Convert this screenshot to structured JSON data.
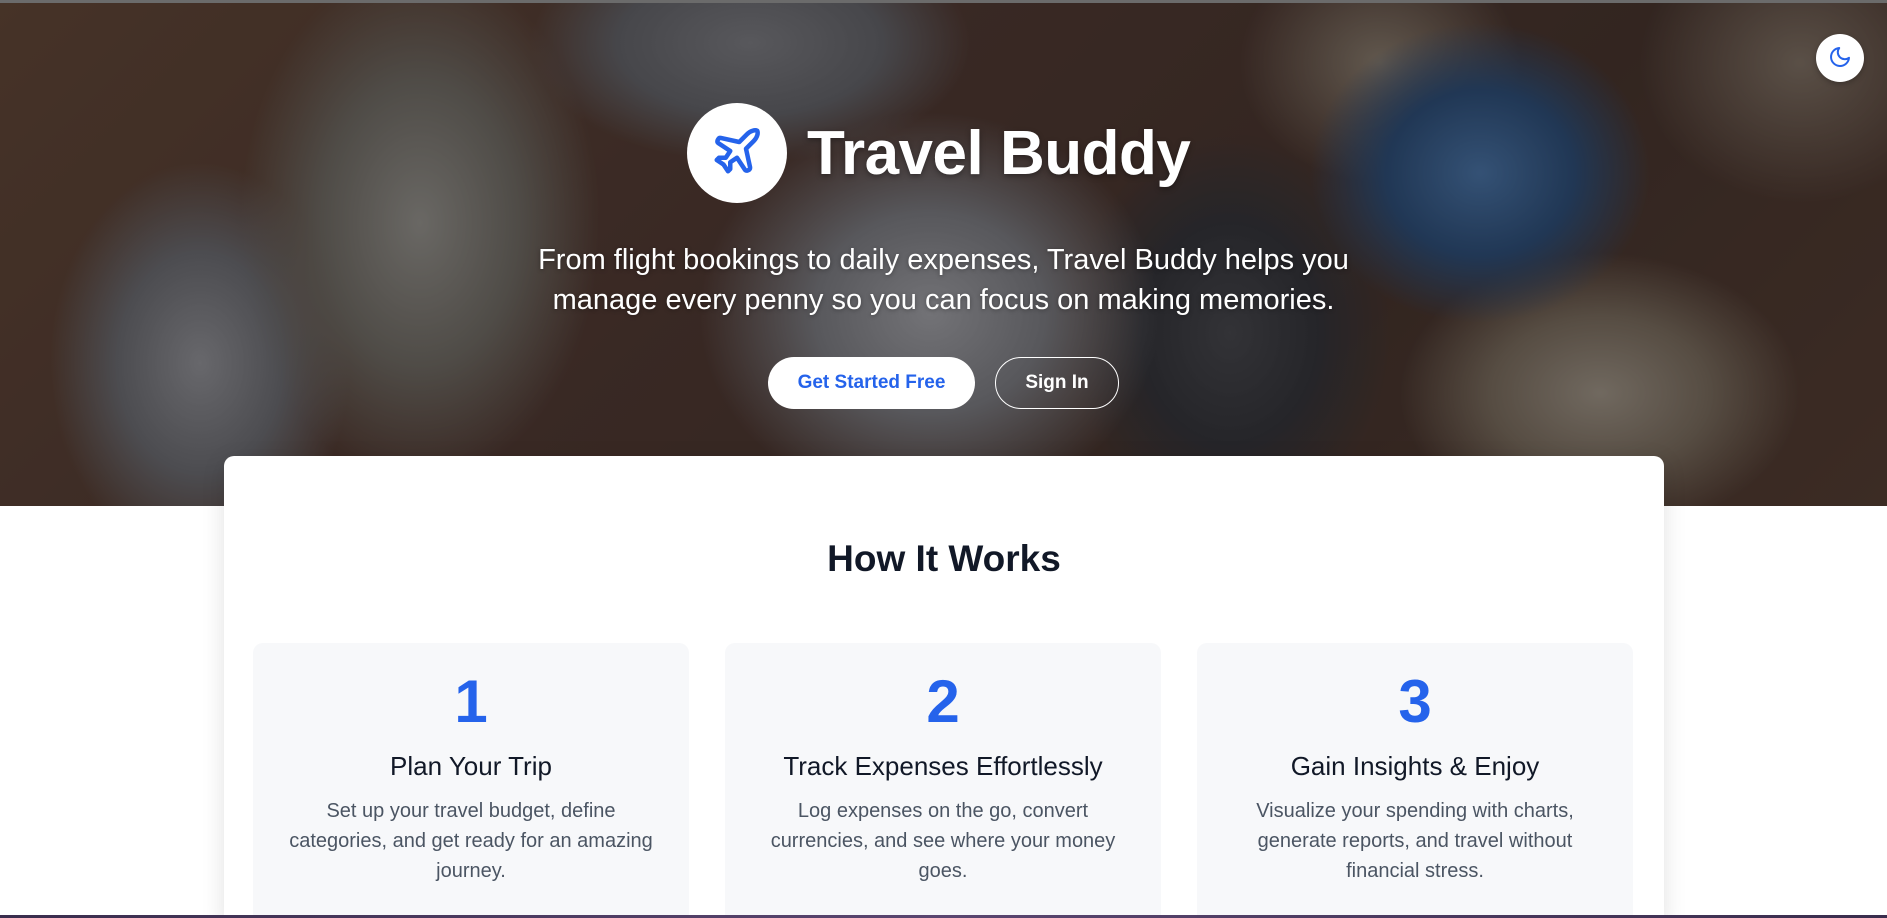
{
  "hero": {
    "title": "Travel Buddy",
    "tagline": "From flight bookings to daily expenses, Travel Buddy helps you manage every penny so you can focus on making memories.",
    "logo_icon": "airplane-icon",
    "theme_toggle_icon": "moon-icon",
    "primary_button": "Get Started Free",
    "secondary_button": "Sign In"
  },
  "how_it_works": {
    "title": "How It Works",
    "steps": [
      {
        "number": "1",
        "title": "Plan Your Trip",
        "description": "Set up your travel budget, define categories, and get ready for an amazing journey."
      },
      {
        "number": "2",
        "title": "Track Expenses Effortlessly",
        "description": "Log expenses on the go, convert currencies, and see where your money goes."
      },
      {
        "number": "3",
        "title": "Gain Insights & Enjoy",
        "description": "Visualize your spending with charts, generate reports, and travel without financial stress."
      }
    ]
  },
  "colors": {
    "accent": "#2563eb",
    "heading": "#111827",
    "body_text": "#4b5563",
    "step_background": "#f7f8fa"
  }
}
